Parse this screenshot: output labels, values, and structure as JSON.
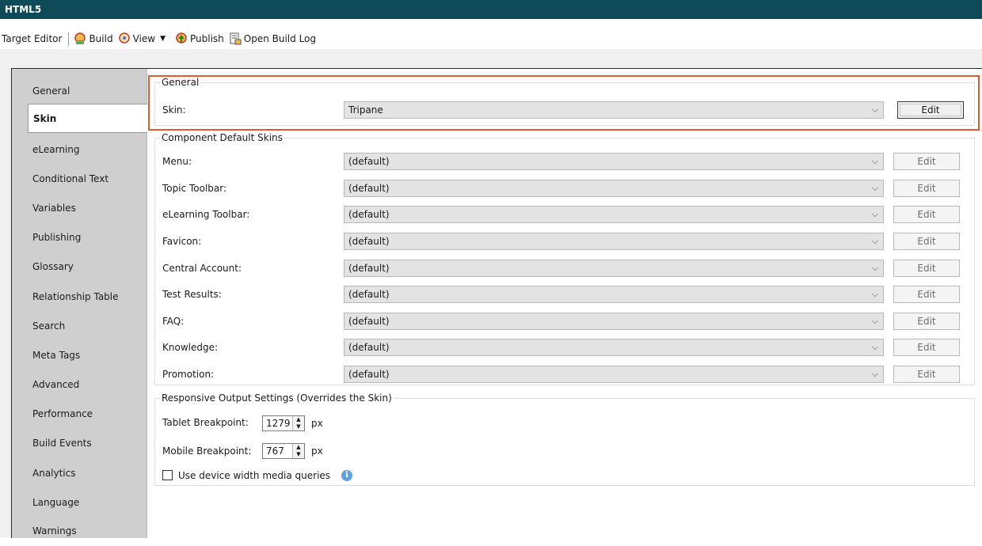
{
  "window": {
    "title": "HTML5"
  },
  "toolbar": {
    "target_editor": "Target Editor",
    "build": "Build",
    "view": "View",
    "publish": "Publish",
    "open_build_log": "Open Build Log"
  },
  "sidebar": {
    "items": [
      "General",
      "Skin",
      "eLearning",
      "Conditional Text",
      "Variables",
      "Publishing",
      "Glossary",
      "Relationship Table",
      "Search",
      "Meta Tags",
      "Advanced",
      "Performance",
      "Build Events",
      "Analytics",
      "Language",
      "Warnings"
    ],
    "active": "Skin"
  },
  "general": {
    "legend": "General",
    "skin_label": "Skin:",
    "skin_value": "Tripane",
    "edit_label": "Edit"
  },
  "component_skins": {
    "legend": "Component Default Skins",
    "rows": [
      {
        "label": "Menu:",
        "value": "(default)",
        "edit": "Edit"
      },
      {
        "label": "Topic Toolbar:",
        "value": "(default)",
        "edit": "Edit"
      },
      {
        "label": "eLearning Toolbar:",
        "value": "(default)",
        "edit": "Edit"
      },
      {
        "label": "Favicon:",
        "value": "(default)",
        "edit": "Edit"
      },
      {
        "label": "Central Account:",
        "value": "(default)",
        "edit": "Edit"
      },
      {
        "label": "Test Results:",
        "value": "(default)",
        "edit": "Edit"
      },
      {
        "label": "FAQ:",
        "value": "(default)",
        "edit": "Edit"
      },
      {
        "label": "Knowledge:",
        "value": "(default)",
        "edit": "Edit"
      },
      {
        "label": "Promotion:",
        "value": "(default)",
        "edit": "Edit"
      }
    ]
  },
  "responsive": {
    "legend": "Responsive Output Settings (Overrides the Skin)",
    "tablet_label": "Tablet Breakpoint:",
    "tablet_value": "1279",
    "mobile_label": "Mobile Breakpoint:",
    "mobile_value": "767",
    "unit": "px",
    "checkbox_label": "Use device width media queries",
    "checkbox_checked": false
  },
  "colors": {
    "titlebar": "#0f4a59",
    "highlight": "#e05a30",
    "sidebar": "#cfcfcf",
    "info": "#5fa2dd"
  }
}
